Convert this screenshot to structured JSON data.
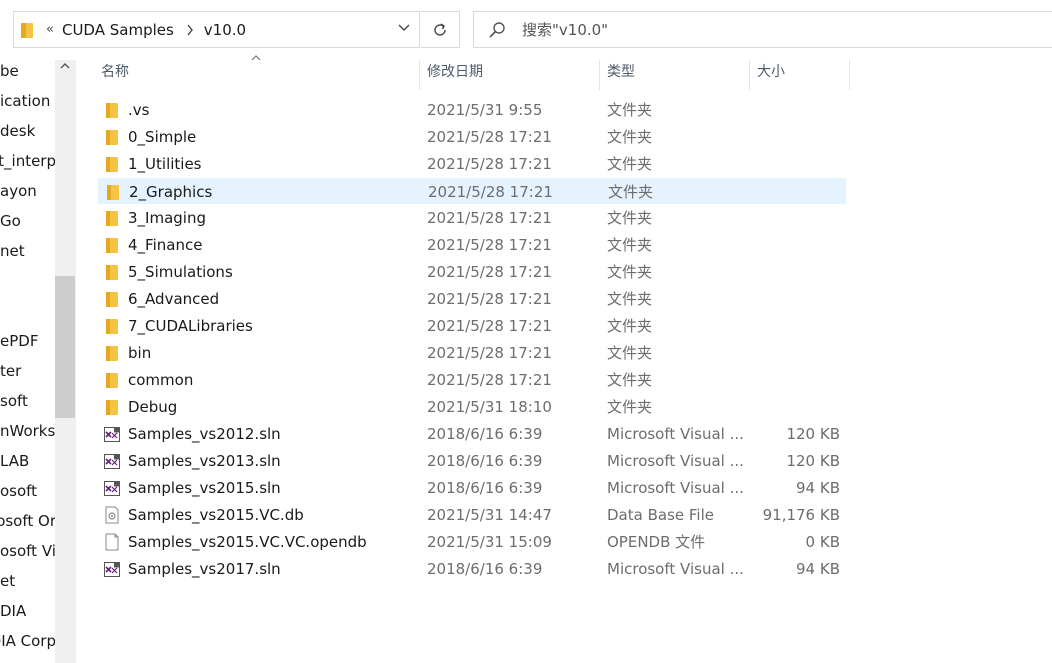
{
  "address": {
    "overflow_glyph": "«",
    "crumbs": [
      "CUDA Samples",
      "v10.0"
    ]
  },
  "search": {
    "placeholder": "搜索\"v10.0\""
  },
  "nav": {
    "items": [
      "be",
      "ication",
      "desk",
      "st_interp",
      "ayon",
      "Go",
      "net",
      "",
      "ePDF",
      "ter",
      "soft",
      "nWorks",
      "LAB",
      "osoft",
      "osoft Or",
      "osoft Vi",
      "et",
      "DIA",
      "DIA Corp"
    ]
  },
  "columns": {
    "name": "名称",
    "date": "修改日期",
    "type": "类型",
    "size": "大小"
  },
  "colors": {
    "selected_row": "#e5f3ff",
    "folder": "#f6c343",
    "vs_purple": "#68217a"
  },
  "files": [
    {
      "name": ".vs",
      "date": "2021/5/31 9:55",
      "type": "文件夹",
      "size": "",
      "icon": "folder-icon"
    },
    {
      "name": "0_Simple",
      "date": "2021/5/28 17:21",
      "type": "文件夹",
      "size": "",
      "icon": "folder-icon"
    },
    {
      "name": "1_Utilities",
      "date": "2021/5/28 17:21",
      "type": "文件夹",
      "size": "",
      "icon": "folder-icon"
    },
    {
      "name": "2_Graphics",
      "date": "2021/5/28 17:21",
      "type": "文件夹",
      "size": "",
      "icon": "folder-icon",
      "selected": true
    },
    {
      "name": "3_Imaging",
      "date": "2021/5/28 17:21",
      "type": "文件夹",
      "size": "",
      "icon": "folder-icon"
    },
    {
      "name": "4_Finance",
      "date": "2021/5/28 17:21",
      "type": "文件夹",
      "size": "",
      "icon": "folder-icon"
    },
    {
      "name": "5_Simulations",
      "date": "2021/5/28 17:21",
      "type": "文件夹",
      "size": "",
      "icon": "folder-icon"
    },
    {
      "name": "6_Advanced",
      "date": "2021/5/28 17:21",
      "type": "文件夹",
      "size": "",
      "icon": "folder-icon"
    },
    {
      "name": "7_CUDALibraries",
      "date": "2021/5/28 17:21",
      "type": "文件夹",
      "size": "",
      "icon": "folder-icon"
    },
    {
      "name": "bin",
      "date": "2021/5/28 17:21",
      "type": "文件夹",
      "size": "",
      "icon": "folder-icon"
    },
    {
      "name": "common",
      "date": "2021/5/28 17:21",
      "type": "文件夹",
      "size": "",
      "icon": "folder-icon"
    },
    {
      "name": "Debug",
      "date": "2021/5/31 18:10",
      "type": "文件夹",
      "size": "",
      "icon": "folder-icon"
    },
    {
      "name": "Samples_vs2012.sln",
      "date": "2018/6/16 6:39",
      "type": "Microsoft Visual ...",
      "size": "120 KB",
      "icon": "vs-solution-icon"
    },
    {
      "name": "Samples_vs2013.sln",
      "date": "2018/6/16 6:39",
      "type": "Microsoft Visual ...",
      "size": "120 KB",
      "icon": "vs-solution-icon"
    },
    {
      "name": "Samples_vs2015.sln",
      "date": "2018/6/16 6:39",
      "type": "Microsoft Visual ...",
      "size": "94 KB",
      "icon": "vs-solution-icon"
    },
    {
      "name": "Samples_vs2015.VC.db",
      "date": "2021/5/31 14:47",
      "type": "Data Base File",
      "size": "91,176 KB",
      "icon": "database-file-icon"
    },
    {
      "name": "Samples_vs2015.VC.VC.opendb",
      "date": "2021/5/31 15:09",
      "type": "OPENDB 文件",
      "size": "0 KB",
      "icon": "blank-file-icon"
    },
    {
      "name": "Samples_vs2017.sln",
      "date": "2018/6/16 6:39",
      "type": "Microsoft Visual ...",
      "size": "94 KB",
      "icon": "vs-solution-icon"
    }
  ]
}
